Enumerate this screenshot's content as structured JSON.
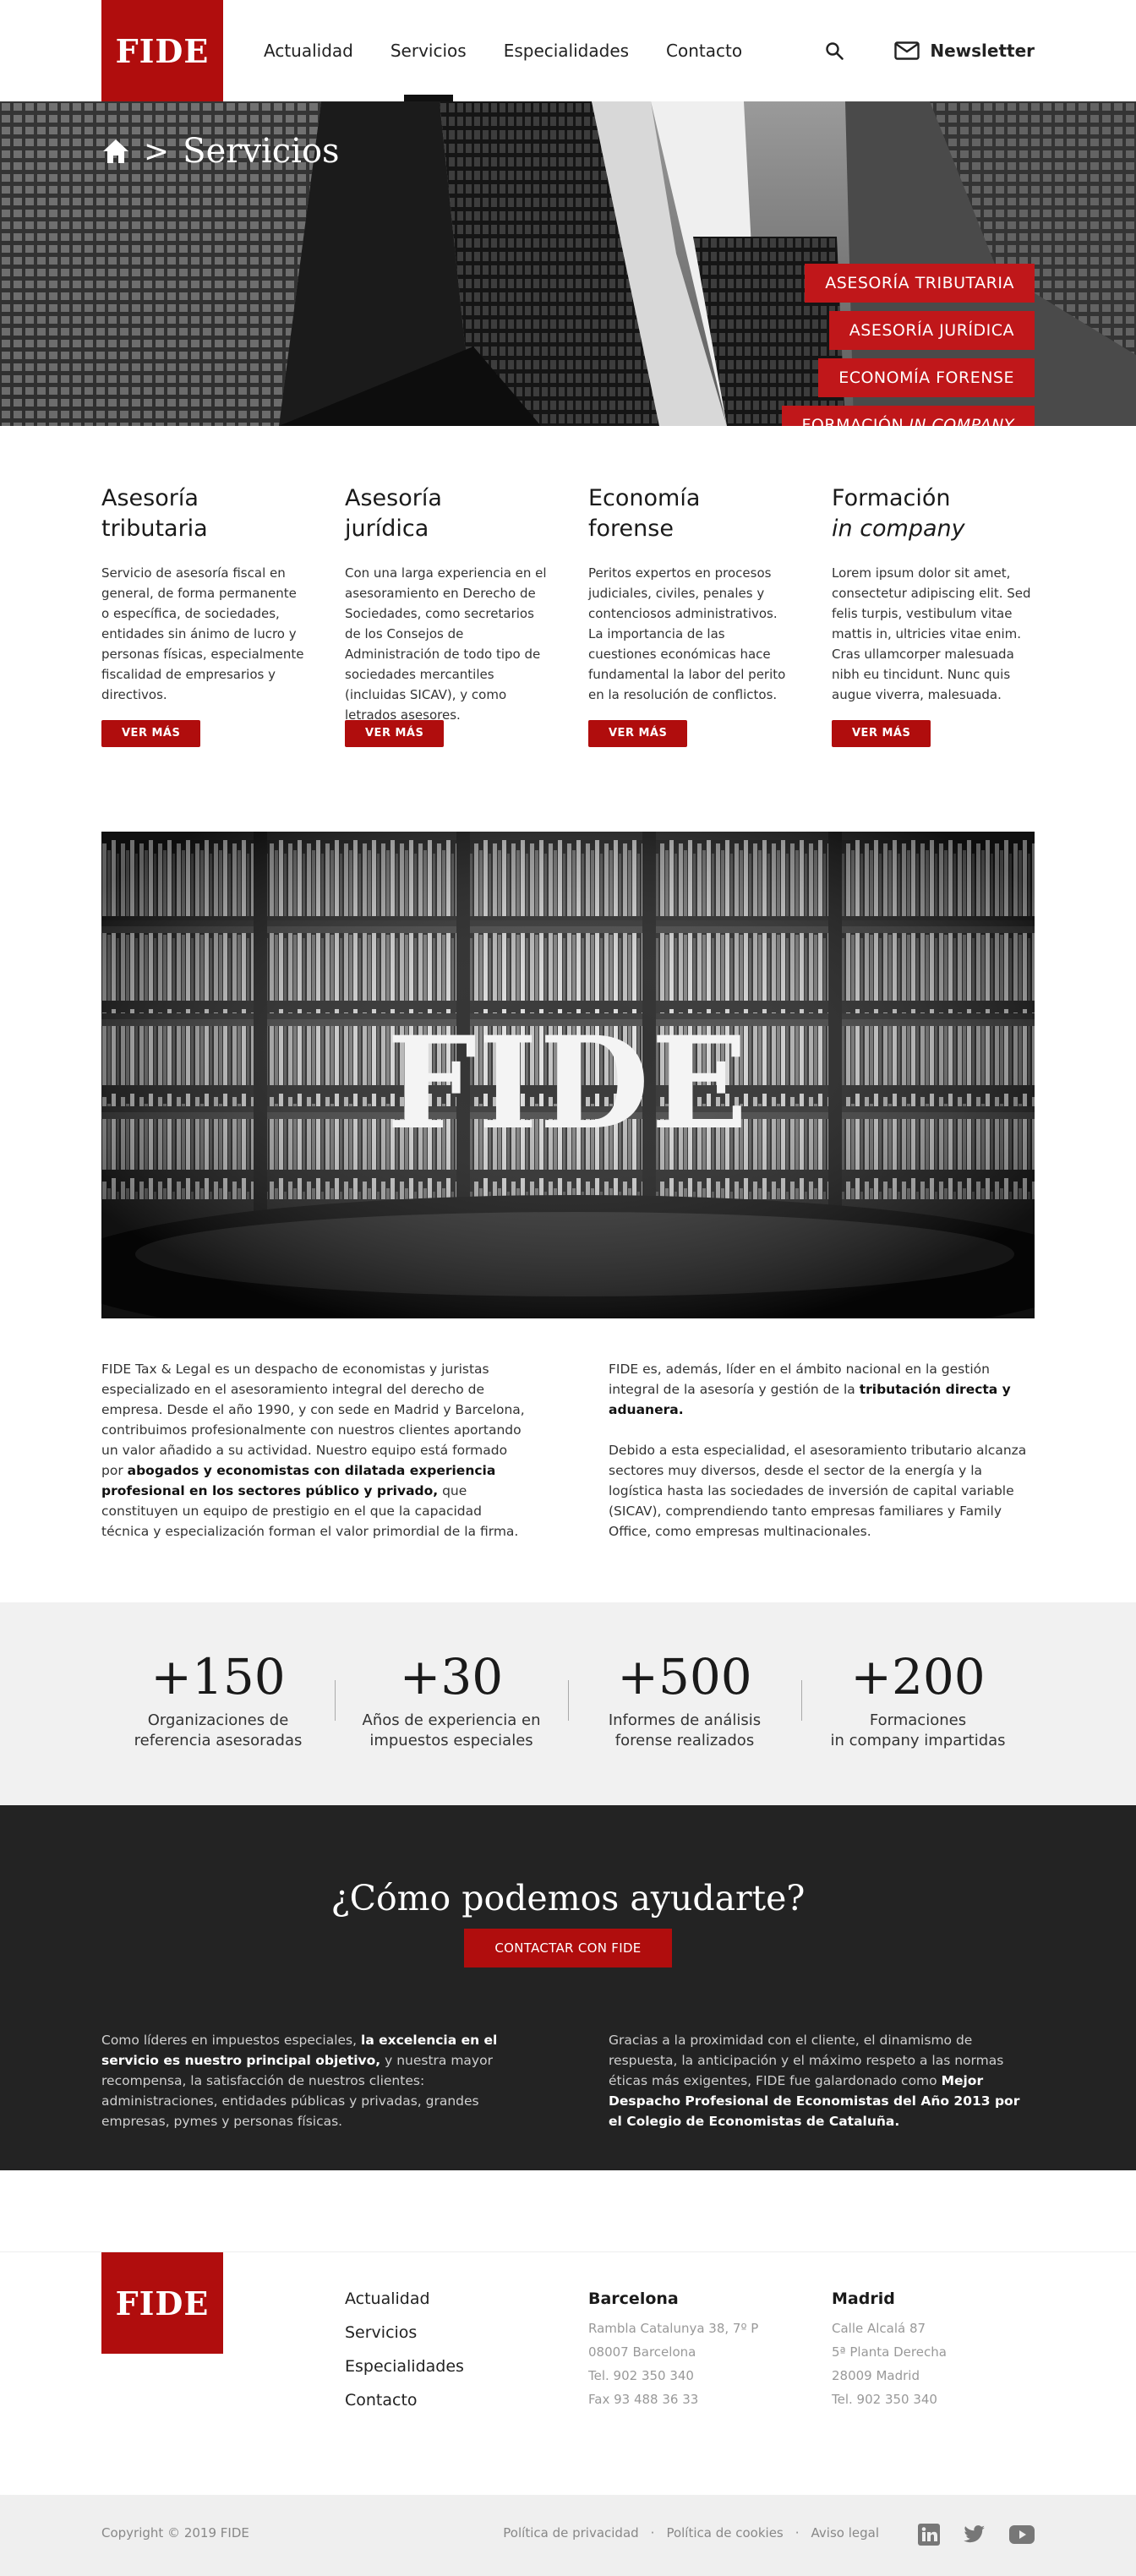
{
  "header": {
    "logo": "FIDE",
    "nav": [
      "Actualidad",
      "Servicios",
      "Especialidades",
      "Contacto"
    ],
    "active_index": 1,
    "newsletter": "Newsletter",
    "search_icon": "search-icon",
    "mail_icon": "mail-icon"
  },
  "hero": {
    "breadcrumb_home_icon": "home-icon",
    "breadcrumb_sep": ">",
    "title": "Servicios",
    "tags": [
      {
        "label": "ASESORÍA TRIBUTARIA",
        "italic": ""
      },
      {
        "label": "ASESORÍA JURÍDICA",
        "italic": ""
      },
      {
        "label": "ECONOMÍA FORENSE",
        "italic": ""
      },
      {
        "label": "FORMACIÓN",
        "italic": "IN COMPANY"
      }
    ]
  },
  "services": [
    {
      "title_1": "Asesoría",
      "title_2": "tributaria",
      "text": "Servicio de asesoría fiscal en general, de forma permanente o específica, de sociedades, entidades sin ánimo de lucro y personas físicas, especialmente fiscalidad de empresarios y directivos.",
      "button": "VER MÁS"
    },
    {
      "title_1": "Asesoría",
      "title_2": "jurídica",
      "text": "Con una larga experiencia en el asesoramiento en Derecho de Sociedades, como secretarios de los Consejos de Administración de todo tipo de sociedades mercantiles (incluidas SICAV), y como letrados asesores.",
      "button": "VER MÁS"
    },
    {
      "title_1": "Economía",
      "title_2": "forense",
      "text": "Peritos expertos en procesos judiciales, civiles, penales y contenciosos administrativos. La importancia de las cuestiones económicas hace fundamental la labor del perito en la resolución de conflictos.",
      "button": "VER MÁS"
    },
    {
      "title_1": "Formación",
      "title_2": "in company",
      "text": "Lorem ipsum dolor sit amet, consectetur adipiscing elit. Sed felis turpis, vestibulum vitae mattis in, ultricies vitae enim. Cras ullamcorper malesuada nibh eu tincidunt. Nunc quis augue viverra, malesuada.",
      "button": "VER MÁS"
    }
  ],
  "library": {
    "overlay_logo": "FIDE"
  },
  "about": {
    "left_1": "FIDE Tax & Legal es un despacho de economistas y juristas especializado en el asesoramiento integral del derecho de empresa. Desde el año 1990, y con sede en Madrid y Barcelona, contribuimos profesionalmente con nuestros clientes aportando un valor añadido a su actividad. Nuestro equipo está formado por ",
    "left_bold": "abogados y economistas con dilatada experiencia profesional en los sectores público y privado,",
    "left_2": " que constituyen un equipo de prestigio en el que la capacidad técnica y especialización forman el valor primordial de la firma.",
    "right_1": "FIDE es, además, líder en el ámbito nacional en la gestión integral de la asesoría y gestión de la ",
    "right_bold": "tributación directa y aduanera.",
    "right_2": "Debido a esta especialidad, el asesoramiento tributario alcanza sectores muy diversos, desde el sector de la energía y la logística hasta las sociedades de inversión de capital variable (SICAV), comprendiendo tanto empresas familiares y Family Office, como empresas multinacionales."
  },
  "stats": [
    {
      "num": "+150",
      "label": "Organizaciones de\nreferencia asesoradas"
    },
    {
      "num": "+30",
      "label": "Años de experiencia en\nimpuestos especiales"
    },
    {
      "num": "+500",
      "label": "Informes de análisis\nforense realizados"
    },
    {
      "num": "+200",
      "label": "Formaciones\nin company impartidas"
    }
  ],
  "help": {
    "title": "¿Cómo podemos ayudarte?",
    "cta": "CONTACTAR CON FIDE",
    "left_1": "Como líderes en impuestos especiales, ",
    "left_bold": "la excelencia en el servicio es nuestro principal objetivo,",
    "left_2": " y nuestra mayor recompensa, la satisfacción de nuestros clientes: administraciones, entidades públicas y privadas, grandes empresas, pymes y personas físicas.",
    "right_1": "Gracias a la proximidad con el cliente, el dinamismo de respuesta, la anticipación y el máximo respeto a las normas éticas más exigentes, FIDE fue galardonado como ",
    "right_bold": "Mejor Despacho Profesional de Economistas del Año 2013 por el Colegio de Economistas de Cataluña."
  },
  "footer": {
    "logo": "FIDE",
    "nav": [
      "Actualidad",
      "Servicios",
      "Especialidades",
      "Contacto"
    ],
    "offices": [
      {
        "city": "Barcelona",
        "lines": [
          "Rambla Catalunya 38, 7º P",
          "08007 Barcelona",
          "Tel. 902 350 340",
          "Fax 93 488 36 33"
        ]
      },
      {
        "city": "Madrid",
        "lines": [
          "Calle Alcalá 87",
          "5ª Planta Derecha",
          "28009 Madrid",
          "Tel. 902 350 340"
        ]
      }
    ]
  },
  "bottom": {
    "copyright": "Copyright © 2019 FIDE",
    "links": [
      "Política de privacidad",
      "Política de cookies",
      "Aviso legal"
    ],
    "separator": "·",
    "social": [
      "linkedin-icon",
      "twitter-icon",
      "youtube-icon"
    ]
  }
}
